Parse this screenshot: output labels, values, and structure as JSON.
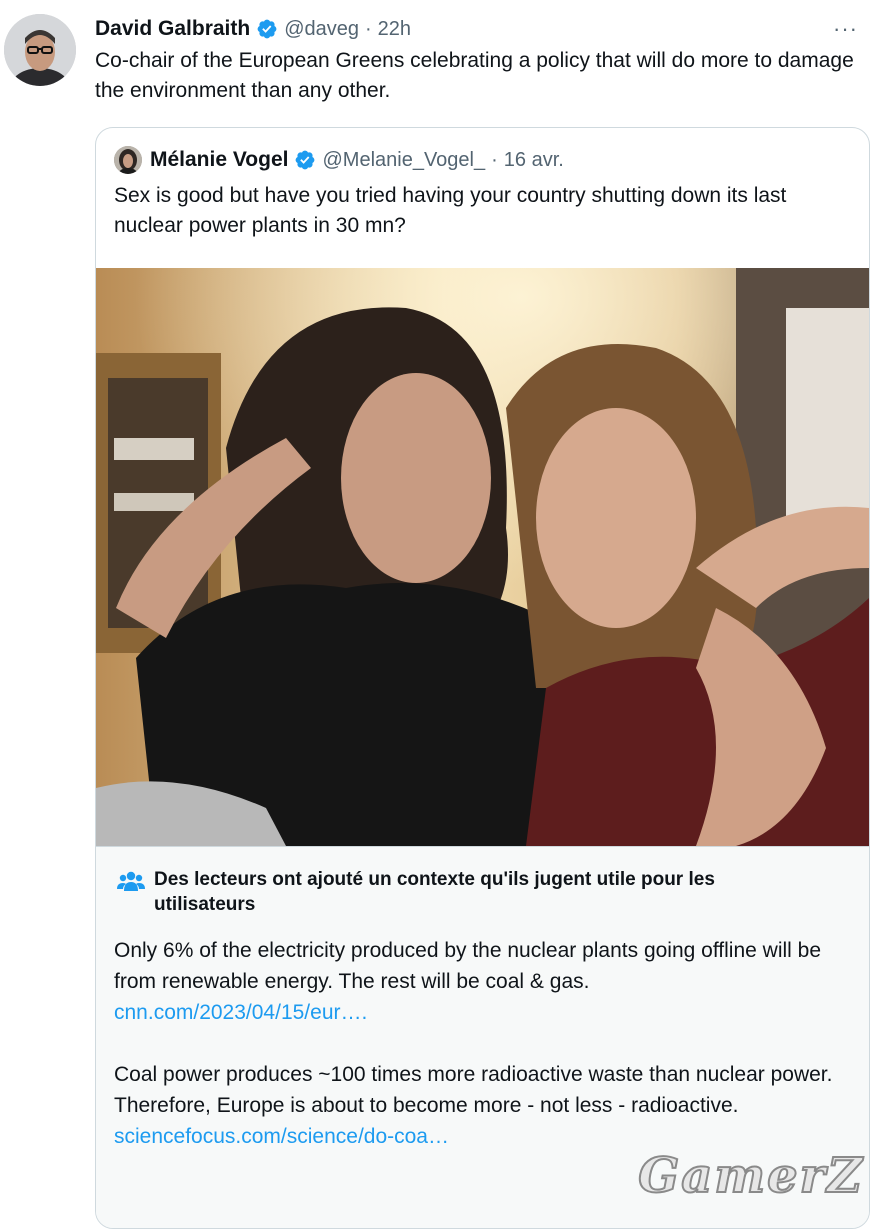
{
  "tweet": {
    "author_name": "David Galbraith",
    "handle": "@daveg",
    "separator": "·",
    "time": "22h",
    "more": "···",
    "text": "Co-chair of the European Greens celebrating a policy that will do more to damage the environment than any other."
  },
  "quoted": {
    "author_name": "Mélanie Vogel",
    "handle": "@Melanie_Vogel_",
    "separator": "·",
    "date": "16 avr.",
    "text": "Sex is good but have you tried having your country shutting down its last nuclear power plants in 30 mn?"
  },
  "community_note": {
    "title": "Des lecteurs ont ajouté un contexte qu'ils jugent utile pour les utilisateurs",
    "para1": "Only 6% of the electricity produced by the nuclear plants going offline will be from renewable energy. The rest will be coal & gas.",
    "link1": "cnn.com/2023/04/15/eur….",
    "para2": "Coal power produces ~100 times more radioactive waste than nuclear power. Therefore, Europe is about to become more - not less - radioactive.",
    "link2": "sciencefocus.com/science/do-coa…"
  },
  "watermark": "GamerZ",
  "colors": {
    "text": "#0f1419",
    "secondary": "#536471",
    "link": "#1d9bf0",
    "verified": "#1d9bf0",
    "note_bg": "#f7f9f9",
    "border": "#cfd9de"
  },
  "icons": {
    "verified": "verified-badge-icon",
    "more": "more-options-icon",
    "note": "community-notes-icon"
  }
}
